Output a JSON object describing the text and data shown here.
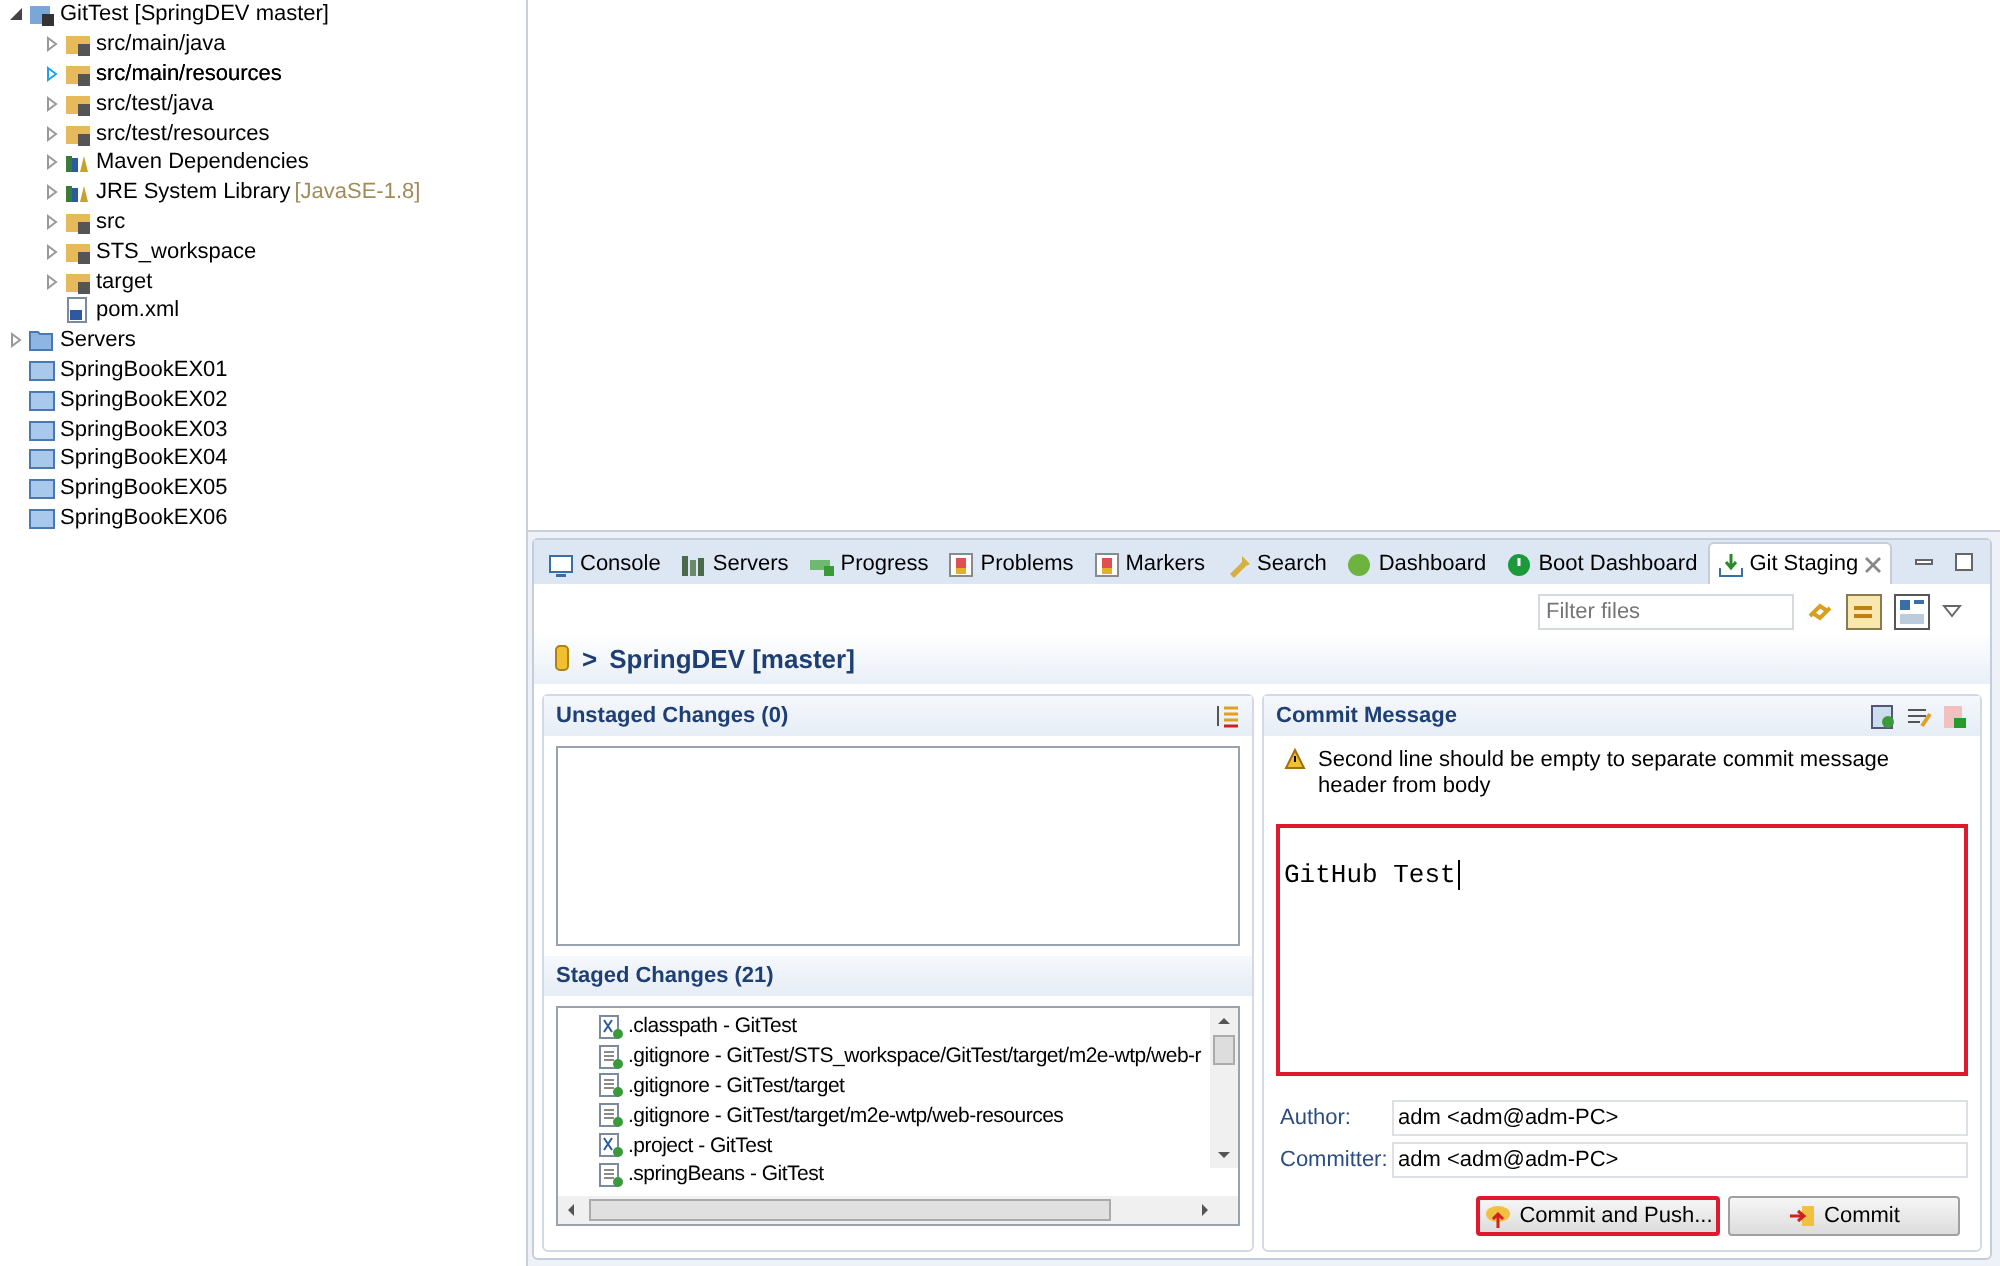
{
  "project_tree": [
    {
      "label": "GitTest [SpringDEV master]",
      "kind": "project",
      "expanded": true,
      "children": [
        {
          "label": "src/main/java",
          "kind": "source",
          "expanded": false,
          "hover": false
        },
        {
          "label": "src/main/resources",
          "kind": "source",
          "expanded": false,
          "hover": true
        },
        {
          "label": "src/test/java",
          "kind": "source",
          "expanded": false,
          "hover": false
        },
        {
          "label": "src/test/resources",
          "kind": "source",
          "expanded": false,
          "hover": false
        },
        {
          "label": "Maven Dependencies",
          "kind": "library",
          "expanded": false,
          "hover": false
        },
        {
          "label": "JRE System Library",
          "decoration": "[JavaSE-1.8]",
          "kind": "library",
          "expanded": false,
          "hover": false
        },
        {
          "label": "src",
          "kind": "folder",
          "expanded": false,
          "hover": false
        },
        {
          "label": "STS_workspace",
          "kind": "folder",
          "expanded": false,
          "hover": false
        },
        {
          "label": "target",
          "kind": "folder",
          "expanded": false,
          "hover": false
        },
        {
          "label": "pom.xml",
          "kind": "file"
        }
      ]
    },
    {
      "label": "Servers",
      "kind": "open-folder",
      "expanded": false
    },
    {
      "label": "SpringBookEX01",
      "kind": "closed-project"
    },
    {
      "label": "SpringBookEX02",
      "kind": "closed-project"
    },
    {
      "label": "SpringBookEX03",
      "kind": "closed-project"
    },
    {
      "label": "SpringBookEX04",
      "kind": "closed-project"
    },
    {
      "label": "SpringBookEX05",
      "kind": "closed-project"
    },
    {
      "label": "SpringBookEX06",
      "kind": "closed-project"
    }
  ],
  "view_tabs": [
    {
      "label": "Console",
      "kind": "console",
      "selected": false
    },
    {
      "label": "Servers",
      "kind": "servers",
      "selected": false
    },
    {
      "label": "Progress",
      "kind": "progress",
      "selected": false
    },
    {
      "label": "Problems",
      "kind": "problems",
      "selected": false
    },
    {
      "label": "Markers",
      "kind": "problems",
      "selected": false
    },
    {
      "label": "Search",
      "kind": "search",
      "selected": false
    },
    {
      "label": "Dashboard",
      "kind": "spring",
      "selected": false
    },
    {
      "label": "Boot Dashboard",
      "kind": "power",
      "selected": false
    },
    {
      "label": "Git Staging",
      "kind": "staging",
      "selected": true
    }
  ],
  "filter": {
    "placeholder": "Filter files"
  },
  "repository": {
    "separator": ">",
    "title": "SpringDEV [master]"
  },
  "unstaged": {
    "title": "Unstaged Changes (0)"
  },
  "staged": {
    "title": "Staged Changes (21)",
    "files": [
      {
        "label": ".classpath - GitTest",
        "kind": "xml"
      },
      {
        "label": ".gitignore - GitTest/STS_workspace/GitTest/target/m2e-wtp/web-r",
        "kind": "text"
      },
      {
        "label": ".gitignore - GitTest/target",
        "kind": "text"
      },
      {
        "label": ".gitignore - GitTest/target/m2e-wtp/web-resources",
        "kind": "text"
      },
      {
        "label": ".project - GitTest",
        "kind": "xml"
      },
      {
        "label": ".springBeans - GitTest",
        "kind": "text"
      }
    ]
  },
  "commit": {
    "title": "Commit Message",
    "warning": "Second line should be empty to separate commit message header from body",
    "message": "GitHub Test",
    "highlighted": true,
    "author_label": "Author:",
    "author": "adm <adm@adm-PC>",
    "committer_label": "Committer:",
    "committer": "adm <adm@adm-PC>"
  },
  "buttons": [
    {
      "label": "Commit and Push...",
      "kind": "push",
      "highlighted": true
    },
    {
      "label": "Commit",
      "kind": "commit",
      "highlighted": false
    }
  ]
}
